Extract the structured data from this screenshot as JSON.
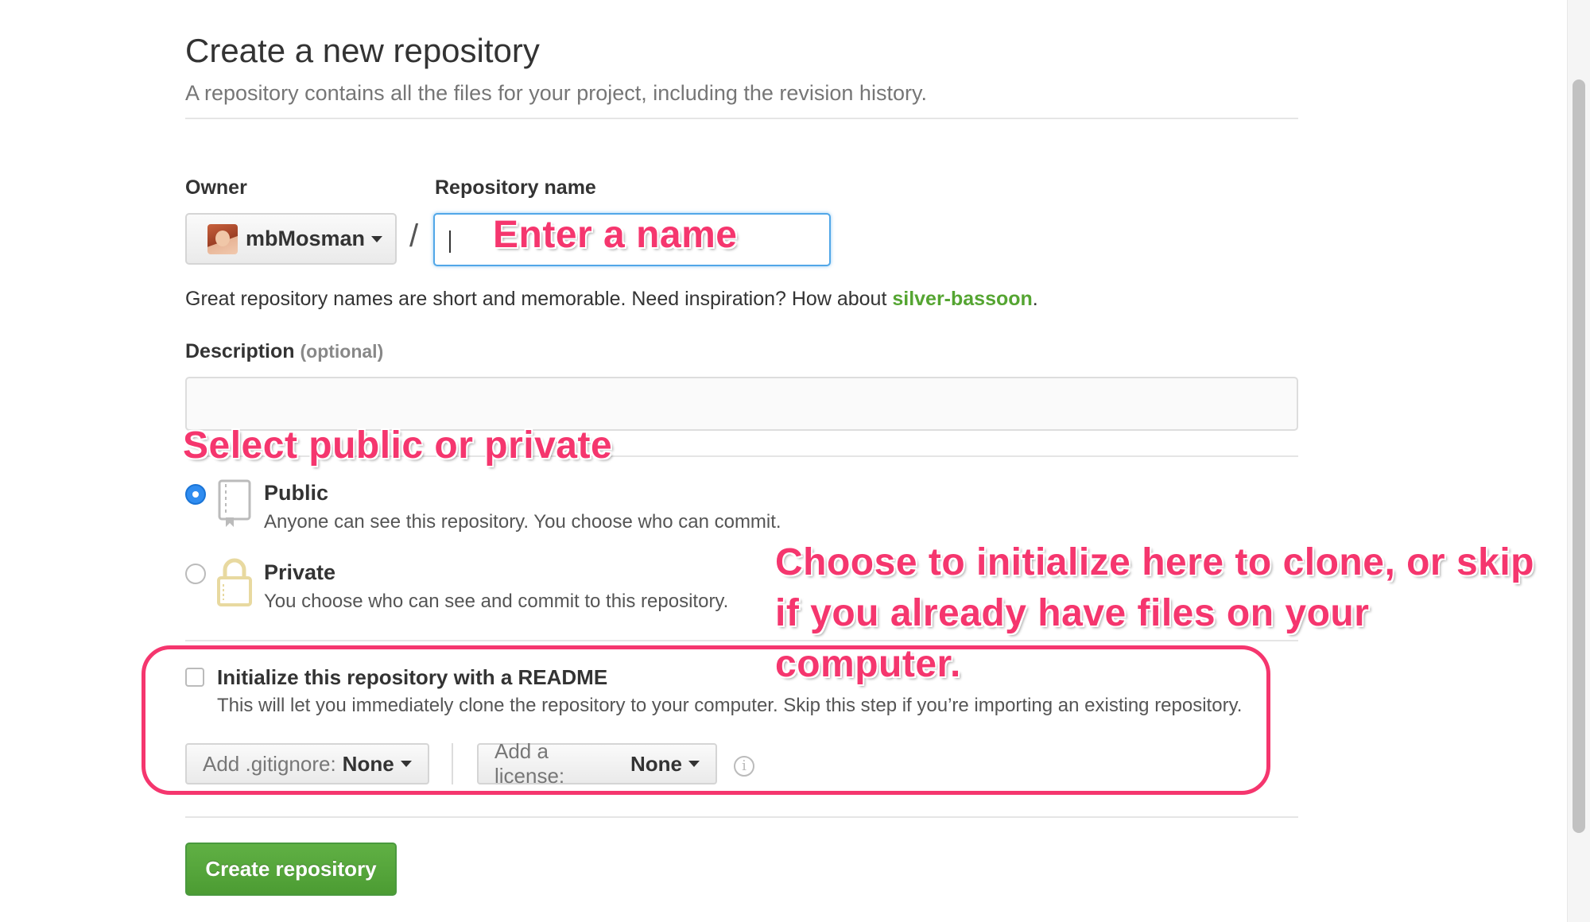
{
  "page": {
    "title": "Create a new repository",
    "subtitle": "A repository contains all the files for your project, including the revision history."
  },
  "owner": {
    "label": "Owner",
    "value": "mbMosman"
  },
  "slash": "/",
  "repo_name": {
    "label": "Repository name",
    "value": ""
  },
  "hint": {
    "prefix": "Great repository names are short and memorable. Need inspiration? How about ",
    "suggestion": "silver-bassoon",
    "suffix": "."
  },
  "description": {
    "label": "Description",
    "optional": "(optional)",
    "value": ""
  },
  "visibility": {
    "selected": "public",
    "public": {
      "title": "Public",
      "desc": "Anyone can see this repository. You choose who can commit."
    },
    "private": {
      "title": "Private",
      "desc": "You choose who can see and commit to this repository."
    }
  },
  "init": {
    "checked": false,
    "title": "Initialize this repository with a README",
    "desc": "This will let you immediately clone the repository to your computer. Skip this step if you’re importing an existing repository."
  },
  "gitignore": {
    "label": "Add .gitignore:",
    "value": "None"
  },
  "license": {
    "label": "Add a license:",
    "value": "None"
  },
  "info_icon": "i",
  "create_button": "Create repository",
  "annotations": {
    "name": "Enter a name",
    "visibility": "Select public or private",
    "init_line1": "Choose to initialize here to clone, or skip",
    "init_line2": "if you already have files on your",
    "init_line3": "computer.",
    "color": "#f5366e"
  },
  "icons": {
    "public": "repo-book-icon",
    "private": "lock-icon",
    "info": "info-icon",
    "caret": "caret-down-icon"
  },
  "colors": {
    "accent_blue": "#51a7e8",
    "green_button": "#55a532",
    "suggestion_green": "#55a532"
  }
}
